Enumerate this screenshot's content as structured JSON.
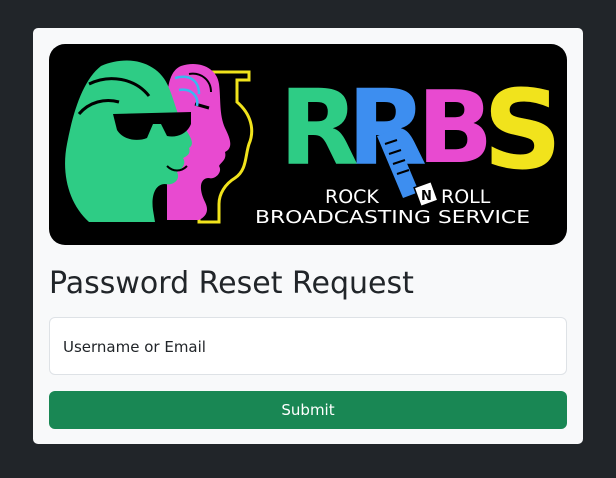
{
  "logo": {
    "letters": [
      "R",
      "R",
      "B",
      "S"
    ],
    "n_letter": "N",
    "line1_left": "ROCK",
    "line1_right": "ROLL",
    "line2": "BROADCASTING SERVICE",
    "colors": {
      "green": "#2ecc85",
      "blue": "#3d8ef0",
      "pink": "#e84ad0",
      "yellow": "#f1e31c",
      "cyan": "#3ab8f0"
    }
  },
  "page": {
    "title": "Password Reset Request"
  },
  "form": {
    "username_label": "Username or Email",
    "submit_label": "Submit"
  },
  "colors": {
    "background": "#212529",
    "card": "#f8f9fa",
    "submit": "#198754"
  }
}
